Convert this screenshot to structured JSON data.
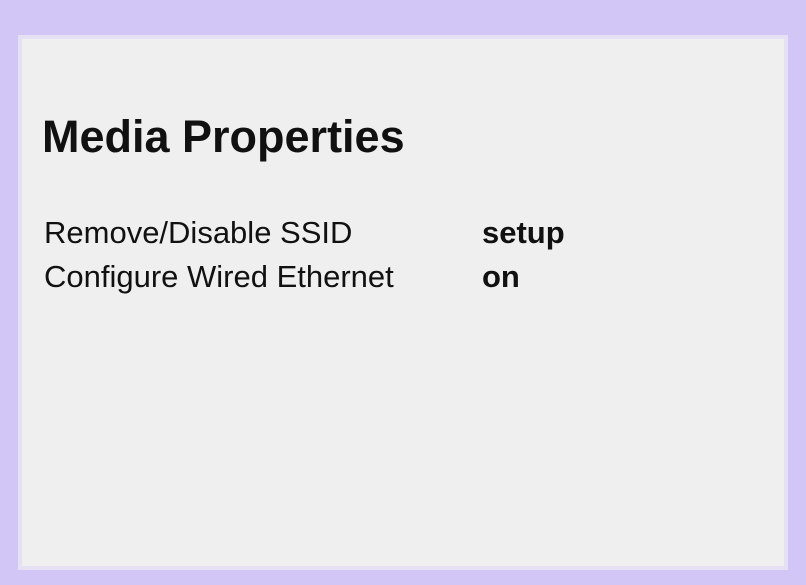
{
  "title": "Media Properties",
  "properties": [
    {
      "label": "Remove/Disable SSID",
      "value": "setup"
    },
    {
      "label": "Configure Wired Ethernet",
      "value": "on"
    }
  ],
  "colors": {
    "frame": "#d2c6f7",
    "panel_background": "#efefef",
    "panel_border": "#e6e0f4",
    "text": "#111111"
  }
}
